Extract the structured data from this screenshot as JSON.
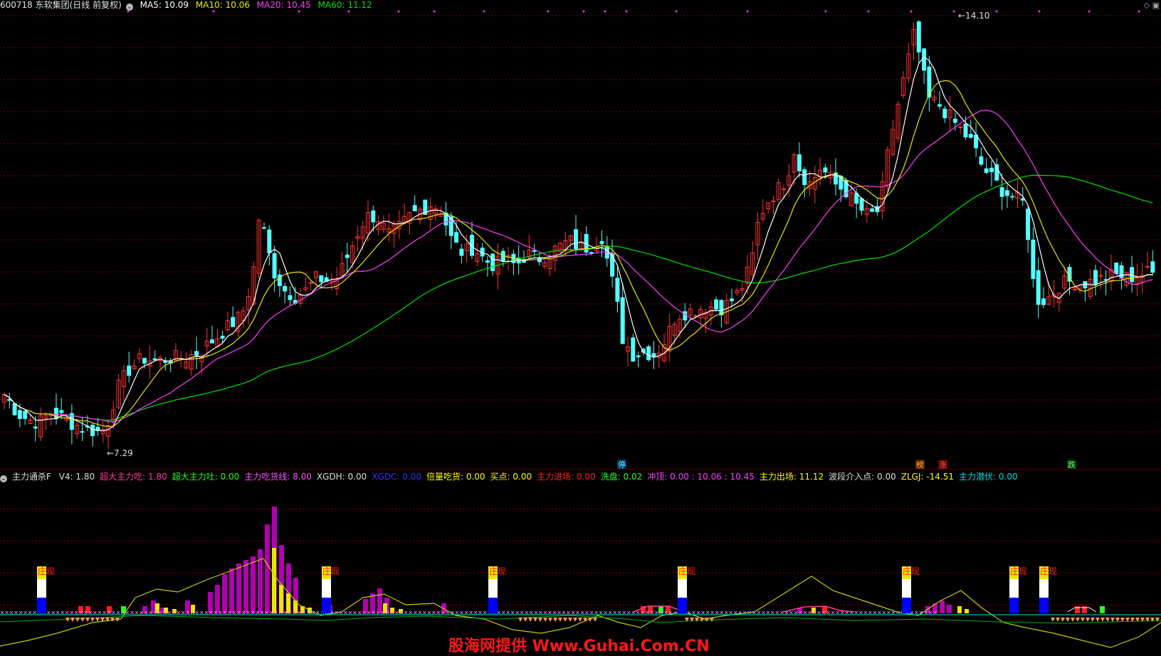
{
  "header": {
    "code_name": "600718 东软集团(日线 前复权)",
    "ma5": "MA5: 10.09",
    "ma10": "MA10: 10.06",
    "ma20": "MA20: 10.45",
    "ma60": "MA60: 11.12"
  },
  "annotations": {
    "high_label": "14.10",
    "low_label": "7.29",
    "event_1": "停",
    "event_2": "榜",
    "event_3": "涨",
    "event_4": "跌",
    "ind_mark": "庄现"
  },
  "indicator": {
    "name": "主力通杀F",
    "items": [
      {
        "text": "V4: 1.80",
        "color": "#dddddd"
      },
      {
        "text": "超大主力吃: 1.80",
        "color": "#ff3aa0"
      },
      {
        "text": "超大主力吐: 0.00",
        "color": "#22ff22"
      },
      {
        "text": "主力吃货线: 8.00",
        "color": "#ff55ff"
      },
      {
        "text": "XGDH: 0.00",
        "color": "#dddddd"
      },
      {
        "text": "XGDC: 0.00",
        "color": "#3333ff"
      },
      {
        "text": "倍量吃货: 0.00",
        "color": "#ffff00"
      },
      {
        "text": "买点: 0.00",
        "color": "#ffff00"
      },
      {
        "text": "主力进场: 0.00",
        "color": "#ff2020"
      },
      {
        "text": "洗盘: 0.02",
        "color": "#22ff22"
      },
      {
        "text": "冲顶: 0.00 : 10.06 : 10.45",
        "color": "#ff44ff"
      },
      {
        "text": "主力出场: 11.12",
        "color": "#ffff00"
      },
      {
        "text": "波段介入点: 0.00",
        "color": "#dddddd"
      },
      {
        "text": "ZLGJ: -14.51",
        "color": "#ffff00"
      },
      {
        "text": "主力潜伏: 0.00",
        "color": "#00dddd"
      }
    ]
  },
  "watermark": "股海网提供 Www.Guhai.Com.CN",
  "colors": {
    "up": "#ff3232",
    "down": "#54ffff",
    "ma5": "#ffffff",
    "ma10": "#e8e800",
    "ma20": "#ff3cff",
    "ma60": "#00e000",
    "grid": "#8b0000"
  },
  "chart_data": {
    "type": "candlestick",
    "price_range": [
      7.29,
      14.1
    ],
    "high": 14.1,
    "low": 7.29,
    "ma_last": {
      "MA5": 10.09,
      "MA10": 10.06,
      "MA20": 10.45,
      "MA60": 11.12
    }
  }
}
